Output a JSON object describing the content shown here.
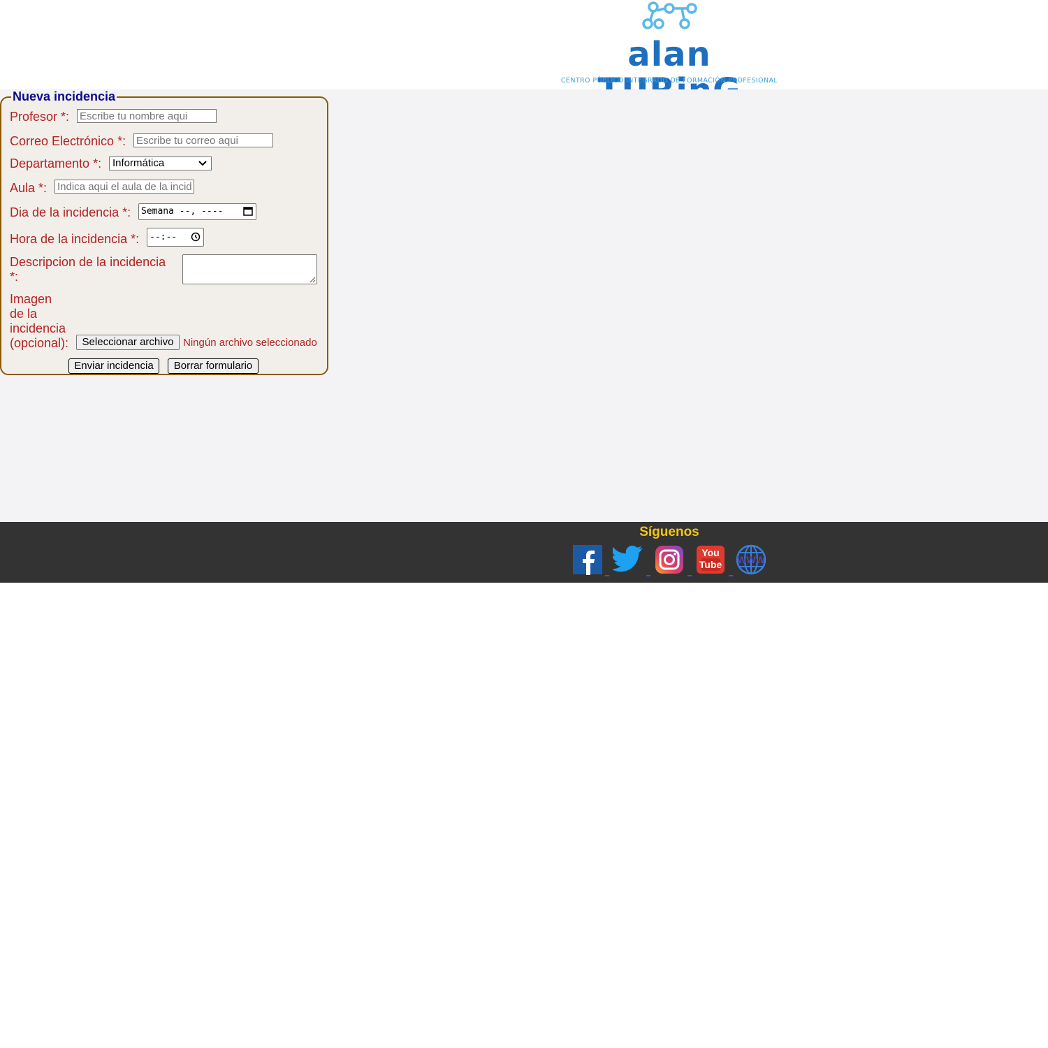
{
  "header": {
    "logo_name": "alan TURinG",
    "logo_subtitle": "CENTRO PÚBLICO INTEGRADO DE FORMACIÓN PROFESIONAL"
  },
  "form": {
    "legend": "Nueva incidencia",
    "profesor": {
      "label": "Profesor *:",
      "placeholder": "Escribe tu nombre aqui"
    },
    "correo": {
      "label": "Correo Electrónico *:",
      "placeholder": "Escribe tu correo aqui"
    },
    "departamento": {
      "label": "Departamento *:",
      "selected": "Informática"
    },
    "aula": {
      "label": "Aula *:",
      "placeholder": "Indica aqui el aula de la incid"
    },
    "dia": {
      "label": "Dia de la incidencia *:",
      "value": "Semana --, ----"
    },
    "hora": {
      "label": "Hora de la incidencia *:",
      "value": "--:--"
    },
    "descripcion": {
      "label_line1": "Descripcion de la incidencia",
      "label_line2": "*:"
    },
    "imagen": {
      "label_lines": [
        "Imagen",
        "de la",
        "incidencia",
        "(opcional):"
      ],
      "button": "Seleccionar archivo",
      "status": "Ningún archivo seleccionado"
    },
    "submit_label": "Enviar incidencia",
    "reset_label": "Borrar formulario"
  },
  "footer": {
    "title": "Síguenos",
    "social": [
      {
        "icon": "facebook-icon"
      },
      {
        "icon": "twitter-icon"
      },
      {
        "icon": "instagram-icon"
      },
      {
        "icon": "youtube-icon"
      },
      {
        "icon": "www-icon",
        "text": "WWW"
      }
    ],
    "youtube_text_1": "You",
    "youtube_text_2": "Tube"
  },
  "colors": {
    "label": "#b22222",
    "legend": "#0c0c8a",
    "footer_bg": "#333333",
    "footer_title": "#f5c518",
    "logo_blue": "#1f6fbf",
    "logo_light_blue": "#3aa0d8"
  }
}
